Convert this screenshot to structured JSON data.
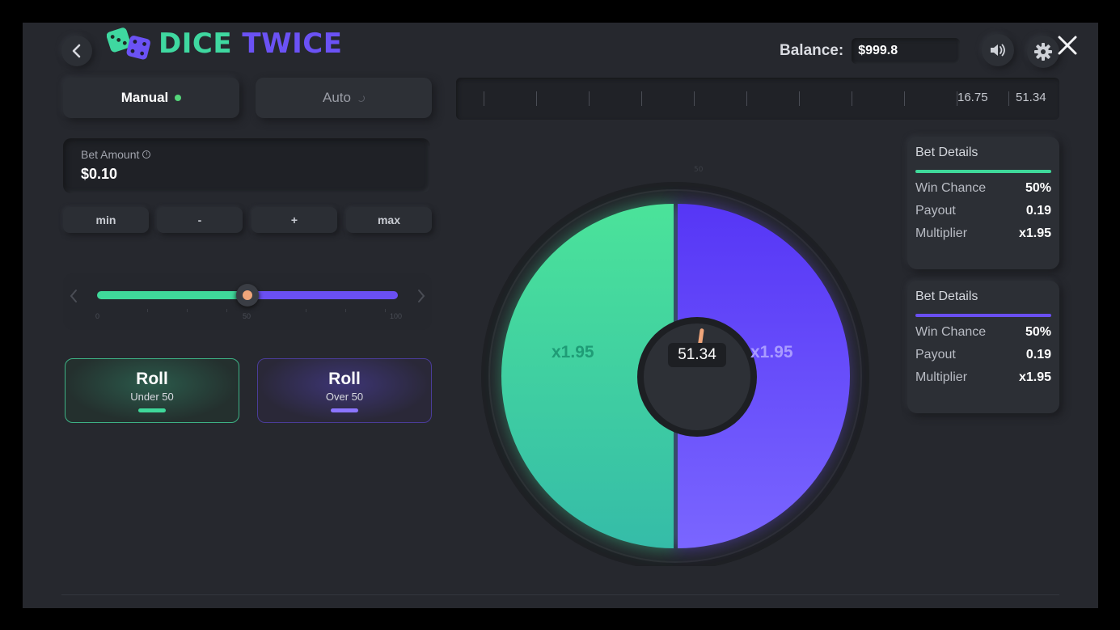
{
  "header": {
    "title_part1": "DICE",
    "title_part2": "TWICE",
    "balance_label": "Balance:",
    "balance_value": "$999.8"
  },
  "tabs": {
    "manual": "Manual",
    "auto": "Auto"
  },
  "bet": {
    "label": "Bet Amount",
    "value": "$0.10",
    "buttons": [
      "min",
      "-",
      "+",
      "max"
    ]
  },
  "slider": {
    "value_percent": 50,
    "ticks": [
      "0",
      "50",
      "100"
    ]
  },
  "roll_under": {
    "title": "Roll",
    "subtitle": "Under 50"
  },
  "roll_over": {
    "title": "Roll",
    "subtitle": "Over 50"
  },
  "history": [
    "16.75",
    "51.34"
  ],
  "wheel": {
    "result": "51.34",
    "left_multiplier": "x1.95",
    "right_multiplier": "x1.95"
  },
  "details_under": {
    "title": "Bet Details",
    "win_chance_label": "Win Chance",
    "win_chance": "50%",
    "payout_label": "Payout",
    "payout": "0.19",
    "multiplier_label": "Multiplier",
    "multiplier": "x1.95"
  },
  "details_over": {
    "title": "Bet Details",
    "win_chance_label": "Win Chance",
    "win_chance": "50%",
    "payout_label": "Payout",
    "payout": "0.19",
    "multiplier_label": "Multiplier",
    "multiplier": "x1.95"
  },
  "colors": {
    "green": "#3fd89a",
    "purple": "#6a4ff2",
    "background": "#26282e"
  },
  "icons": {
    "back": "chevron-left-icon",
    "sound": "speaker-icon",
    "settings": "gear-icon",
    "close": "close-icon",
    "logo": "dice-icon"
  }
}
